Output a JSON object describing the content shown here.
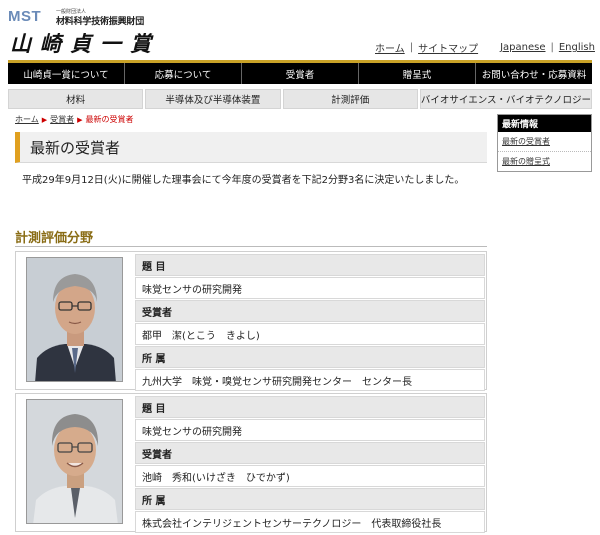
{
  "header": {
    "logo_mst": "MST",
    "org_small": "一般財団法人",
    "org_name": "材料科学技術振興財団",
    "calligraphy": "山崎貞一賞",
    "util_links": [
      "ホーム",
      "サイトマップ"
    ],
    "lang_links": [
      "Japanese",
      "English"
    ]
  },
  "main_nav": [
    "山崎貞一賞について",
    "応募について",
    "受賞者",
    "贈呈式",
    "お問い合わせ・応募資料"
  ],
  "sub_nav": [
    "材料",
    "半導体及び半導体装置",
    "計測評価",
    "バイオサイエンス・バイオテクノロジー"
  ],
  "breadcrumb": {
    "items": [
      "ホーム",
      "受賞者"
    ],
    "current": "最新の受賞者"
  },
  "page_title": "最新の受賞者",
  "intro": "平成29年9月12日(火)に開催した理事会にて今年度の受賞者を下記2分野3名に決定いたしました。",
  "section_title": "計測評価分野",
  "awardees": [
    {
      "label_title": "題 目",
      "title": "味覚センサの研究開発",
      "label_name": "受賞者",
      "name": "都甲　潔(とこう　きよし)",
      "label_affil": "所 属",
      "affiliation": "九州大学　味覚・嗅覚センサ研究開発センター　センター長"
    },
    {
      "label_title": "題 目",
      "title": "味覚センサの研究開発",
      "label_name": "受賞者",
      "name": "池崎　秀和(いけざき　ひでかず)",
      "label_affil": "所 属",
      "affiliation": "株式会社インテリジェントセンサーテクノロジー　代表取締役社長"
    }
  ],
  "sidebar": {
    "heading": "最新情報",
    "links": [
      "最新の受賞者",
      "最新の贈呈式"
    ]
  },
  "colors": {
    "accent_gold": "#c9a227",
    "section_title": "#8a6d16",
    "breadcrumb_current": "#cc0000"
  }
}
